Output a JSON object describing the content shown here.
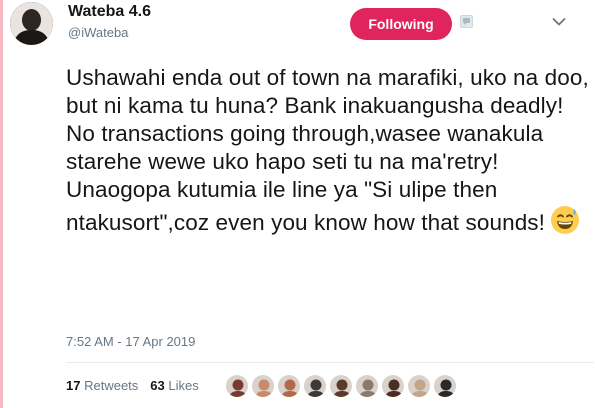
{
  "user": {
    "display_name": "Wateba 4.6",
    "handle": "@iWateba"
  },
  "follow_button": {
    "label": "Following",
    "color": "#e0245e"
  },
  "icons": {
    "translate": "translate-icon",
    "caret": "chevron-down-icon",
    "emoji": "grinning-sweat-emoji"
  },
  "tweet": {
    "text": "Ushawahi enda out of town na marafiki, uko na doo, but ni kama tu huna? Bank inakuangusha deadly! No transactions going through,wasee wanakula starehe wewe uko hapo seti tu na ma'retry! Unaogopa kutumia ile line ya \"Si ulipe then ntakusort\",coz even you know how that sounds!",
    "timestamp": "7:52 AM - 17 Apr 2019"
  },
  "stats": {
    "retweets_count": "17",
    "retweets_label": "Retweets",
    "likes_count": "63",
    "likes_label": "Likes"
  },
  "likers": [
    {
      "color": "#7a3b2e"
    },
    {
      "color": "#c98a6b"
    },
    {
      "color": "#b06a4a"
    },
    {
      "color": "#3a3a3a"
    },
    {
      "color": "#5a3a2a"
    },
    {
      "color": "#8a7a6a"
    },
    {
      "color": "#4a2e22"
    },
    {
      "color": "#c4a58a"
    },
    {
      "color": "#2a2a2a"
    }
  ],
  "accent_colors": {
    "left_border": "#f4b9c4",
    "muted_text": "#657786"
  }
}
